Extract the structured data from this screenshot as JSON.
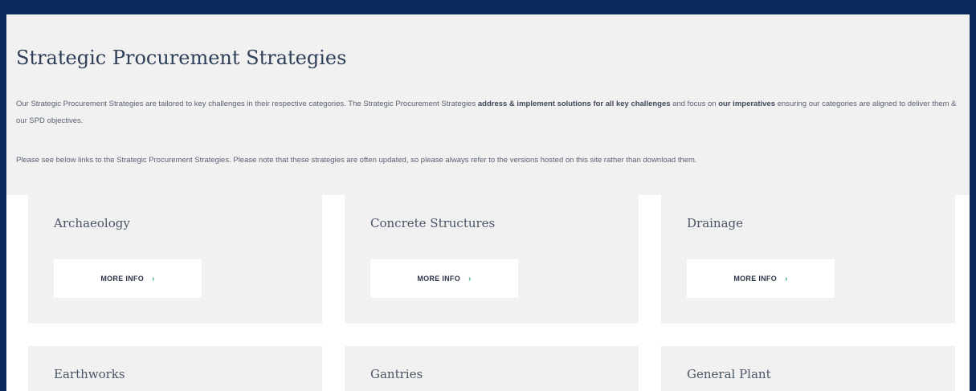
{
  "header": {
    "title": "Strategic Procurement Strategies"
  },
  "intro": {
    "p1": {
      "t1": "Our Strategic Procurement Strategies are tailored to key challenges in their respective categories.  The Strategic Procurement Strategies ",
      "b1": "address & implement solutions for all key challenges",
      "t2": " and focus on ",
      "b2": "our imperatives",
      "t3": " ensuring our categories are aligned to deliver them & our SPD objectives."
    },
    "p2": "Please see below links to the Strategic Procurement Strategies.  Please note that these strategies are often updated, so please always refer to the versions hosted on this site rather than download them."
  },
  "cards": [
    {
      "title": "Archaeology",
      "button": "MORE INFO",
      "chevron": "›"
    },
    {
      "title": "Concrete Structures",
      "button": "MORE INFO",
      "chevron": "›"
    },
    {
      "title": "Drainage",
      "button": "MORE INFO",
      "chevron": "›"
    },
    {
      "title": "Earthworks"
    },
    {
      "title": "Gantries"
    },
    {
      "title": "General Plant"
    }
  ],
  "colors": {
    "frame": "#0b2a5c",
    "panel": "#f1f1f2",
    "accent": "#2fae7d"
  }
}
